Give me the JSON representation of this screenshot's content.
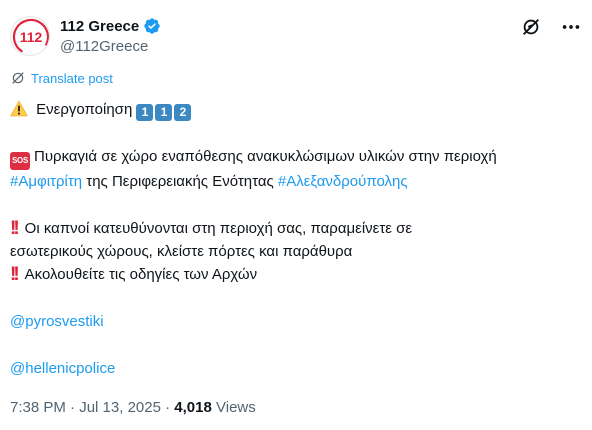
{
  "author": {
    "display_name": "112 Greece",
    "handle": "@112Greece",
    "avatar_text": "112"
  },
  "translate": {
    "label": "Translate post"
  },
  "post": {
    "line1": {
      "text": "Ενεργοποίηση",
      "keycaps": [
        "1",
        "1",
        "2"
      ]
    },
    "line2": {
      "sos": "SOS",
      "text": "Πυρκαγιά σε χώρο εναπόθεσης ανακυκλώσιμων υλικών στην περιοχή"
    },
    "line3": {
      "hashtag1": "#Αμφιτρίτη",
      "text": " της Περιφερειακής Ενότητας ",
      "hashtag2": "#Αλεξανδρούπολης"
    },
    "line4": {
      "text": "Οι καπνοί κατευθύνονται στη περιοχή σας, παραμείνετε σε"
    },
    "line5": {
      "text": "εσωτερικούς χώρους, κλείστε πόρτες και παράθυρα"
    },
    "line6": {
      "text": "Ακολουθείτε τις οδηγίες των Αρχών"
    },
    "mention1": "@pyrosvestiki",
    "mention2": "@hellenicpolice",
    "emoji_icons": [
      "warning-icon",
      "sos-icon",
      "double-exclamation-icon"
    ]
  },
  "meta": {
    "time": "7:38 PM",
    "separator": " · ",
    "date": "Jul 13, 2025",
    "views_count": "4,018",
    "views_label": " Views"
  },
  "colors": {
    "accent": "#1d9bf0",
    "text": "#0f1419",
    "muted": "#536471",
    "brand": "#e0243a"
  }
}
